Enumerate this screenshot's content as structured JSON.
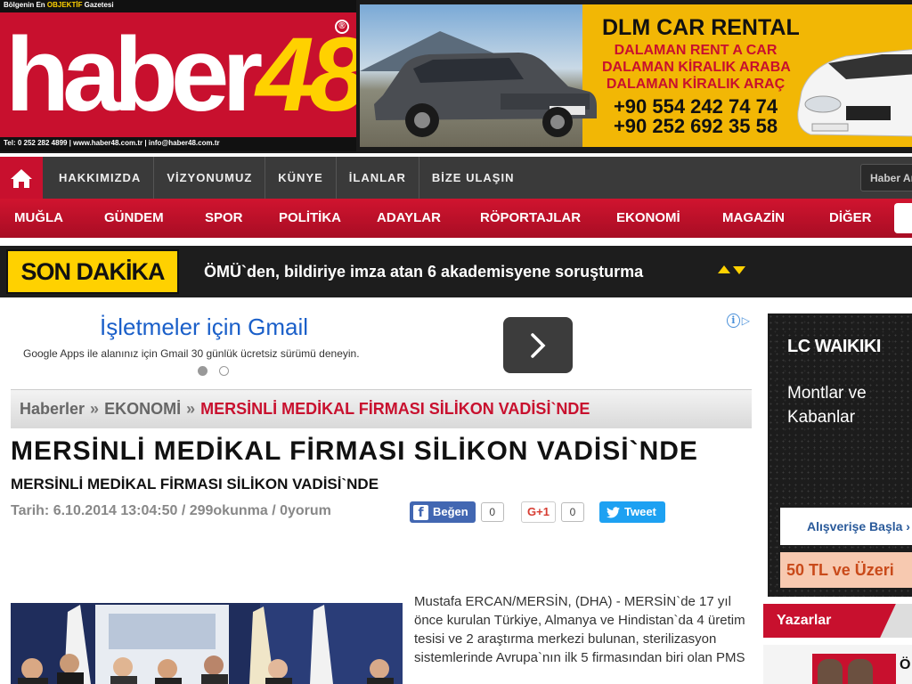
{
  "header": {
    "slogan_prefix": "Bölgenin En ",
    "slogan_highlight": "OBJEKTİF",
    "slogan_suffix": " Gazetesi",
    "logo_word": "haber",
    "logo_number": "48",
    "registered": "®",
    "contact_line": "Tel: 0 252 282 4899 | www.haber48.com.tr | info@haber48.com.tr"
  },
  "banner_ad": {
    "title": "DLM CAR RENTAL",
    "line1": "DALAMAN RENT A CAR",
    "line2": "DALAMAN KİRALIK ARABA",
    "line3": "DALAMAN KİRALIK ARAÇ",
    "phone1": "+90 554 242 74 74",
    "phone2": "+90 252 692 35 58"
  },
  "top_nav": {
    "items": [
      "HAKKIMIZDA",
      "VİZYONUMUZ",
      "KÜNYE",
      "İLANLAR",
      "BİZE ULAŞIN"
    ],
    "search_placeholder": "Haber Ara"
  },
  "category_nav": {
    "items": [
      "MUĞLA",
      "GÜNDEM",
      "SPOR",
      "POLİTİKA",
      "ADAYLAR",
      "RÖPORTAJLAR",
      "EKONOMİ",
      "MAGAZİN",
      "DİĞER"
    ]
  },
  "breaking": {
    "label": "SON DAKİKA",
    "headline": "ÖMÜ`den, bildiriye imza atan 6 akademisyene soruşturma"
  },
  "ad": {
    "title": "İşletmeler için Gmail",
    "description": "Google Apps ile alanınız için Gmail 30 günlük ücretsiz sürümü deneyin."
  },
  "breadcrumb": {
    "home": "Haberler",
    "category": "EKONOMİ",
    "current": "MERSİNLİ MEDİKAL FİRMASI SİLİKON VADİSİ`NDE",
    "separator": "»"
  },
  "article": {
    "title": "MERSİNLİ MEDİKAL FİRMASI SİLİKON VADİSİ`NDE",
    "subtitle": "MERSİNLİ MEDİKAL FİRMASI SİLİKON VADİSİ`NDE",
    "meta": "Tarih: 6.10.2014 13:04:50 / 299okunma / 0yorum",
    "body": "Mustafa ERCAN/MERSİN, (DHA) - MERSİN`de 17 yıl önce kurulan Türkiye, Almanya ve Hindistan`da 4 üretim tesisi ve 2 araştırma merkezi bulunan, sterilizasyon sistemlerinde Avrupa`nın ilk 5 firmasından biri olan PMS"
  },
  "social": {
    "facebook_label": "Beğen",
    "facebook_count": "0",
    "gplus_label": "G+1",
    "gplus_count": "0",
    "twitter_label": "Tweet"
  },
  "side_ad": {
    "brand": "LC WAIKIKI",
    "tagline": "Montlar ve Kabanlar",
    "cta": "Alışverişe Başla ›",
    "offer": "50 TL ve Üzeri"
  },
  "writers": {
    "title": "Yazarlar",
    "initial": "Ö"
  },
  "colors": {
    "brand_red": "#c8102e",
    "accent_yellow": "#ffd100",
    "nav_dark": "#3a3a3a",
    "link_blue": "#1a5fc9"
  }
}
